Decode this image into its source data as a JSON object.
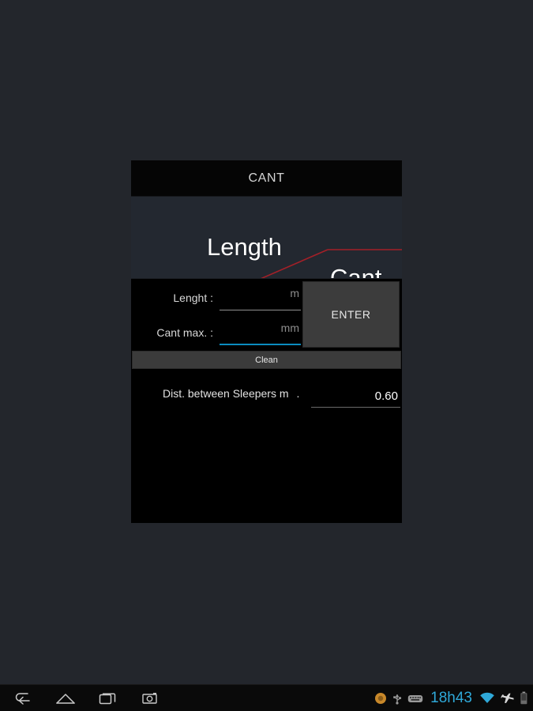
{
  "app": {
    "title": "CANT"
  },
  "banner": {
    "label_length": "Length",
    "label_cant": "Cant",
    "line_color": "#a32028",
    "background": "#232830"
  },
  "form": {
    "fields": [
      {
        "label": "Lenght  :",
        "value": "",
        "unit": "m",
        "focused": false
      },
      {
        "label": "Cant max. :",
        "value": "",
        "unit": "mm",
        "focused": true
      }
    ],
    "enter_label": "ENTER",
    "clean_label": "Clean"
  },
  "result": {
    "label": "Dist. between Sleepers m",
    "separator": ".",
    "value": "0.60"
  },
  "navbar": {
    "back_icon": "back-arrow-icon",
    "home_icon": "home-icon",
    "recents_icon": "recent-apps-icon",
    "screenshot_icon": "camera-icon"
  },
  "statusbar": {
    "notification_icon": "circle-notification-icon",
    "usb_icon": "usb-icon",
    "keyboard_icon": "keyboard-icon",
    "time": "18h43",
    "wifi_icon": "wifi-icon",
    "airplane_icon": "airplane-mode-icon",
    "battery_icon": "battery-icon",
    "accent_color": "#2fa8d8"
  }
}
